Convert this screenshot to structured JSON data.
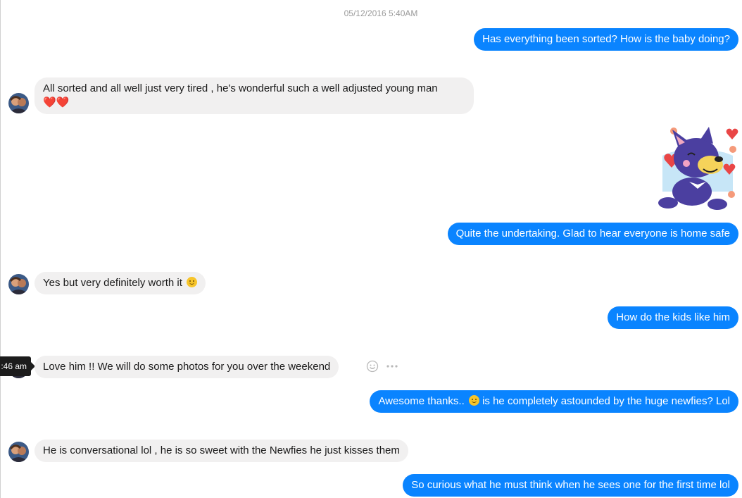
{
  "conversation": {
    "date_header": "05/12/2016 5:40AM",
    "hover_time": ":46 am",
    "messages": [
      {
        "dir": "out",
        "text": "Has everything been sorted? How is the baby doing?"
      },
      {
        "dir": "in",
        "text": "All sorted and all well just very tired , he's wonderful such a well adjusted young man",
        "emoji_after": "❤️❤️"
      },
      {
        "dir": "out",
        "type": "sticker",
        "sticker": "happy-dog-with-hearts-sticker"
      },
      {
        "dir": "out",
        "text": "Quite the undertaking. Glad to hear everyone is home safe"
      },
      {
        "dir": "in",
        "text": "Yes but very definitely worth it",
        "emoji_after": "wink-emoji"
      },
      {
        "dir": "out",
        "text": "How do the kids like him"
      },
      {
        "dir": "in",
        "text": "Love him !! We will do some photos for you over the weekend"
      },
      {
        "dir": "out",
        "text_before": "Awesome thanks..",
        "emoji": "smile-emoji",
        "text_after": "is he completely astounded by the huge newfies? Lol"
      },
      {
        "dir": "in",
        "text": "He is conversational lol , he is so sweet with the Newfies he just kisses them"
      },
      {
        "dir": "out",
        "text": "So curious what he must think when he sees one for the first time lol"
      }
    ]
  },
  "colors": {
    "outgoing_bubble": "#0a84ff",
    "incoming_bubble": "#f1f0f0",
    "timestamp": "#9a9a9a"
  }
}
